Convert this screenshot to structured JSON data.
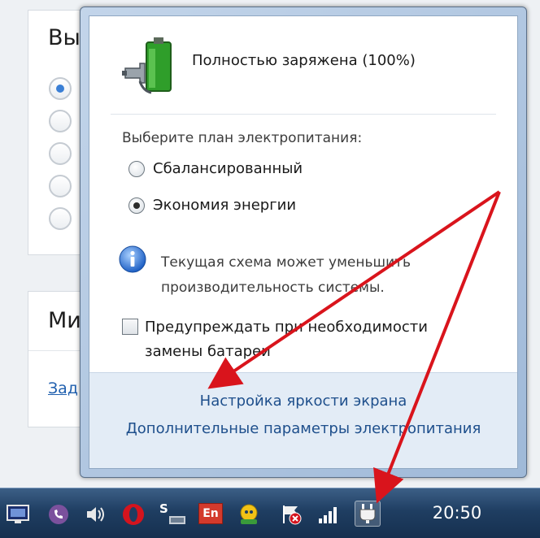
{
  "background_window": {
    "section1_title": "Вы",
    "section2_title": "Ми",
    "link": "Зад"
  },
  "popup": {
    "battery_status": "Полностью заряжена (100%)",
    "plan_heading": "Выберите план электропитания:",
    "plans": [
      {
        "label": "Сбалансированный",
        "selected": false
      },
      {
        "label": "Экономия энергии",
        "selected": true
      }
    ],
    "info_line1": "Текущая схема может уменьшить",
    "info_line2": "производительность системы.",
    "warn_checkbox_label": "Предупреждать при необходимости замены батареи",
    "links": {
      "brightness": "Настройка яркости экрана",
      "advanced": "Дополнительные параметры электропитания"
    }
  },
  "taskbar": {
    "lang": "En",
    "clock": "20:50",
    "s_icon_label": "S"
  },
  "colors": {
    "accent_link": "#1e4f8c",
    "annotation_arrow": "#d9141c",
    "taskbar": "#1f3e62"
  },
  "icons": [
    "battery-charging-icon",
    "info-icon",
    "monitor-icon",
    "viber-icon",
    "volume-icon",
    "opera-icon",
    "skype-icon",
    "language-icon",
    "messenger-icon",
    "action-center-flag-icon",
    "network-signal-icon",
    "power-plug-icon"
  ]
}
